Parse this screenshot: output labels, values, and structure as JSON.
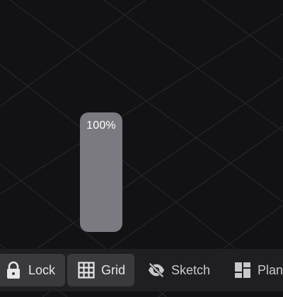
{
  "zoom": {
    "label": "100%",
    "level_percent": 100
  },
  "toolbar": {
    "items": [
      {
        "label": "Lock",
        "icon": "lock-icon",
        "active": true
      },
      {
        "label": "Grid",
        "icon": "grid-icon",
        "active": true
      },
      {
        "label": "Sketch",
        "icon": "eye-off-icon",
        "active": false
      },
      {
        "label": "Plan",
        "icon": "plan-icon",
        "active": false
      }
    ]
  },
  "colors": {
    "canvas": "#121214",
    "slider": "#7b7a80",
    "toolbar": "#1f1f22",
    "active_tool": "#3a3a3e"
  }
}
